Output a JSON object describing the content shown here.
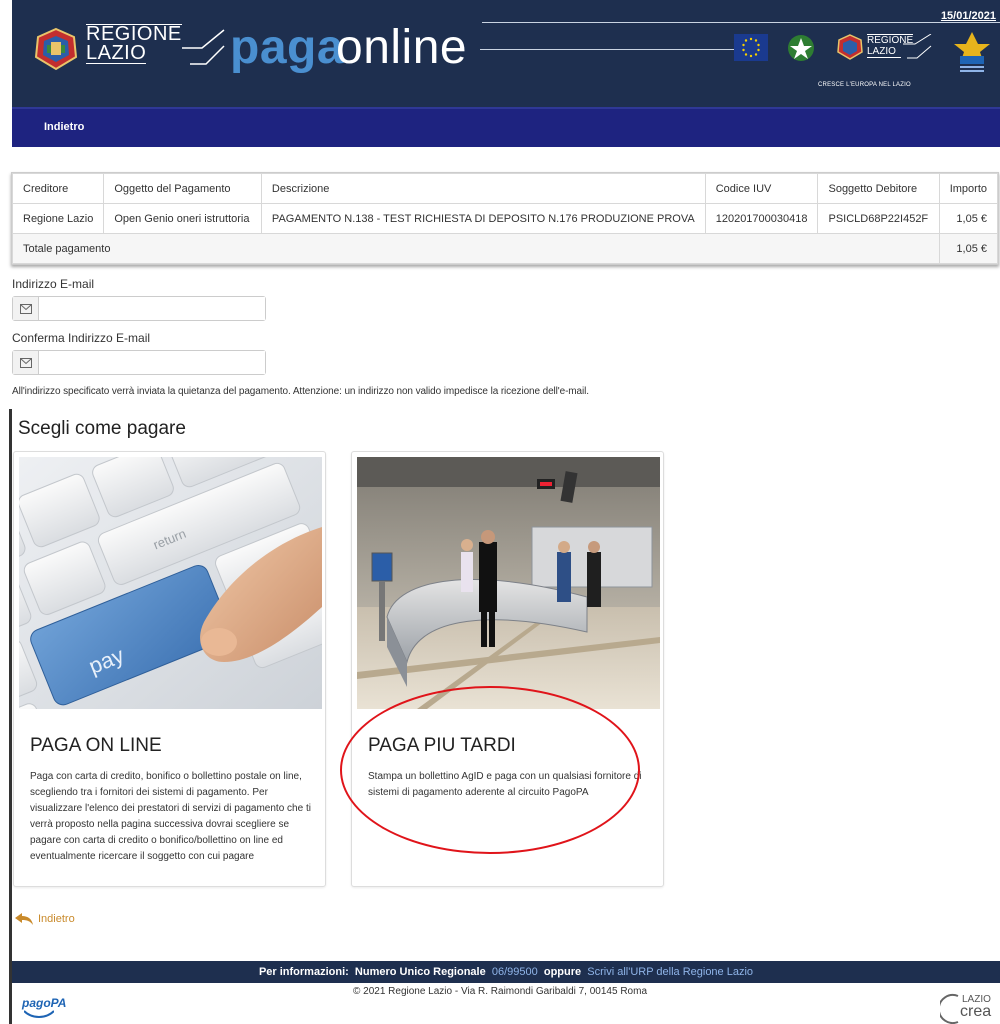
{
  "header": {
    "date": "15/01/2021",
    "region_line1": "REGIONE",
    "region_line2": "LAZIO",
    "brand_paga": "paga",
    "brand_online": "online",
    "logo_region_line1": "REGIONE",
    "logo_region_line2": "LAZIO",
    "eu_slogan": "CRESCE L'EUROPA NEL LAZIO"
  },
  "nav": {
    "back_label": "Indietro"
  },
  "table": {
    "headers": [
      "Creditore",
      "Oggetto del Pagamento",
      "Descrizione",
      "Codice IUV",
      "Soggetto Debitore",
      "Importo"
    ],
    "rows": [
      [
        "Regione Lazio",
        "Open Genio oneri istruttoria",
        "PAGAMENTO N.138 - TEST RICHIESTA DI DEPOSITO N.176 PRODUZIONE PROVA",
        "120201700030418",
        "PSICLD68P22I452F",
        "1,05 €"
      ]
    ],
    "total_label": "Totale pagamento",
    "total_value": "1,05 €"
  },
  "email": {
    "label": "Indirizzo E-mail",
    "value": "",
    "confirm_label": "Conferma Indirizzo E-mail",
    "confirm_value": "",
    "note": "All'indirizzo specificato verrà inviata la quietanza del pagamento. Attenzione: un indirizzo non valido impedisce la ricezione dell'e-mail."
  },
  "choose": {
    "title": "Scegli come pagare",
    "online": {
      "title": "PAGA ON LINE",
      "key_label": "pay",
      "text": "Paga con carta di credito, bonifico o bollettino postale on line, scegliendo tra i fornitori dei sistemi di pagamento. Per visualizzare l'elenco dei prestatori di servizi di pagamento che ti verrà proposto nella pagina successiva dovrai scegliere se pagare con carta di credito o bonifico/bollettino on line ed eventualmente ricercare il soggetto con cui pagare"
    },
    "later": {
      "title": "PAGA PIU TARDI",
      "text": "Stampa un bollettino AgID e paga con un qualsiasi fornitore di sistemi di pagamento aderente al circuito PagoPA"
    }
  },
  "back_link": "Indietro",
  "footer": {
    "info_label": "Per informazioni:",
    "numero_label": "Numero Unico Regionale",
    "numero": "06/99500",
    "oppure": "oppure",
    "urp_link": "Scrivi all'URP della Regione Lazio",
    "copyright": "© 2021 Regione Lazio - Via R. Raimondi Garibaldi 7, 00145 Roma",
    "pagopa": "pagoPA",
    "lazio_line1": "LAZIO",
    "lazio_line2": "crea"
  },
  "colors": {
    "header_bg": "#1e2f4f",
    "nav_bg": "#1e2380",
    "brand_blue": "#4a8fd0",
    "highlight_red": "#e0141a",
    "back_orange": "#c98a2b"
  }
}
